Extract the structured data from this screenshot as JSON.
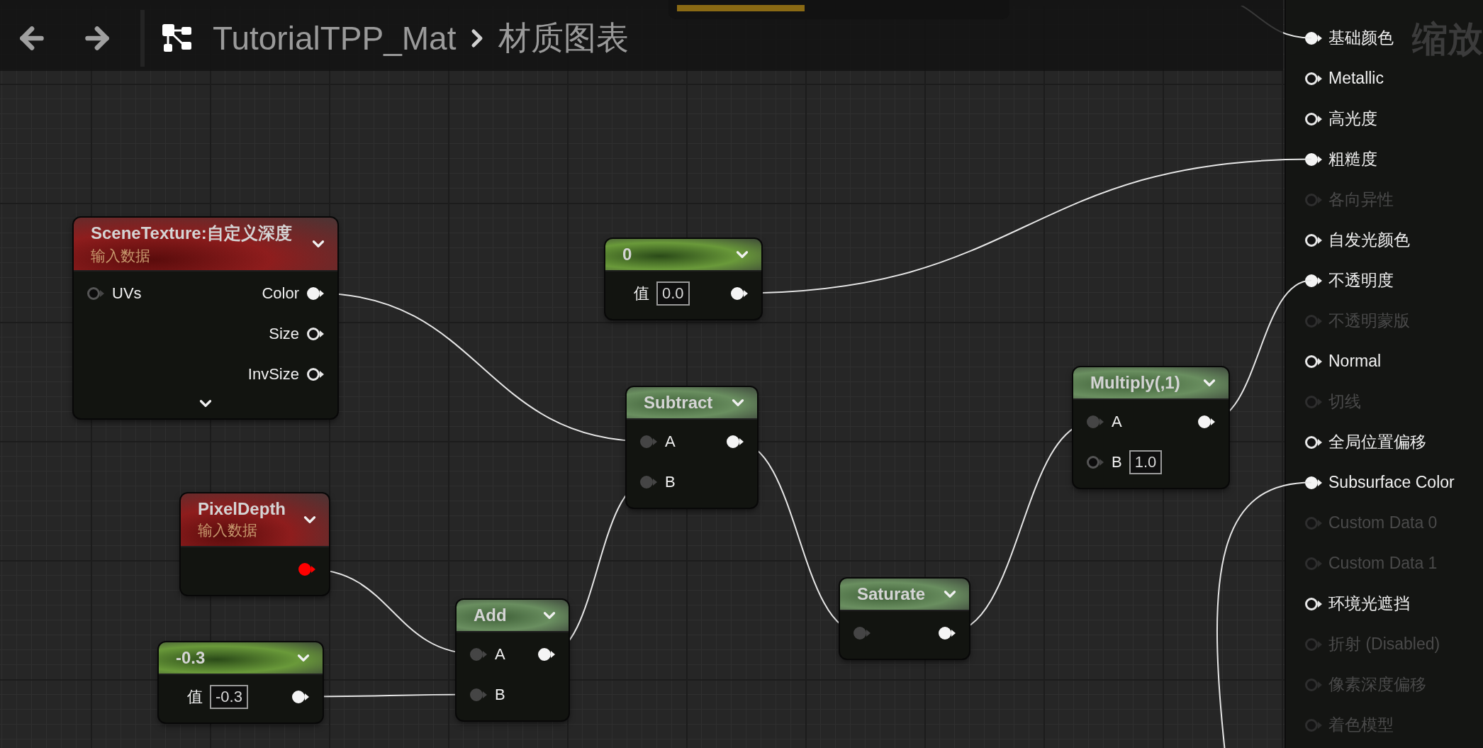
{
  "toolbar": {
    "breadcrumb": [
      {
        "label": "TutorialTPP_Mat"
      },
      {
        "label": "材质图表"
      }
    ],
    "zoom_label": "缩放"
  },
  "nodes": [
    {
      "kind": "texture",
      "title": "SceneTexture:自定义深度",
      "subtitle": "输入数据",
      "expandable": true,
      "rows": [
        {
          "input": {
            "label": "UVs",
            "connected": false
          },
          "output": {
            "label": "Color",
            "connected": true
          }
        },
        {
          "output": {
            "label": "Size",
            "connected": false
          }
        },
        {
          "output": {
            "label": "InvSize",
            "connected": false
          }
        }
      ]
    },
    {
      "kind": "constant",
      "title": "0",
      "expandable": false,
      "rows": [
        {
          "value_label": "值",
          "value": "0.0",
          "output": {
            "connected": true
          }
        }
      ]
    },
    {
      "kind": "math",
      "title": "Subtract",
      "expandable": false,
      "rows": [
        {
          "input": {
            "label": "A",
            "connected": true
          },
          "output": {
            "connected": true
          }
        },
        {
          "input": {
            "label": "B",
            "connected": true
          }
        }
      ]
    },
    {
      "kind": "texture",
      "title": "PixelDepth",
      "subtitle": "输入数据",
      "expandable": false,
      "rows": [
        {
          "output": {
            "connected": true,
            "color": "#ff0000"
          }
        }
      ]
    },
    {
      "kind": "constant",
      "title": "-0.3",
      "expandable": false,
      "rows": [
        {
          "value_label": "值",
          "value": "-0.3",
          "output": {
            "connected": true
          }
        }
      ]
    },
    {
      "kind": "math",
      "title": "Add",
      "expandable": false,
      "rows": [
        {
          "input": {
            "label": "A",
            "connected": true
          },
          "output": {
            "connected": true
          }
        },
        {
          "input": {
            "label": "B",
            "connected": true
          }
        }
      ]
    },
    {
      "kind": "math",
      "title": "Saturate",
      "expandable": false,
      "rows": [
        {
          "input": {
            "connected": true
          },
          "output": {
            "connected": true
          }
        }
      ]
    },
    {
      "kind": "math",
      "title": "Multiply(,1)",
      "expandable": false,
      "rows": [
        {
          "input": {
            "label": "A",
            "connected": true
          },
          "output": {
            "connected": true
          }
        },
        {
          "input": {
            "label": "B",
            "connected": false,
            "value": "1.0"
          }
        }
      ]
    }
  ],
  "material_outputs": [
    {
      "label": "基础颜色",
      "connected": true,
      "disabled": false
    },
    {
      "label": "Metallic",
      "connected": false,
      "disabled": false
    },
    {
      "label": "高光度",
      "connected": false,
      "disabled": false
    },
    {
      "label": "粗糙度",
      "connected": true,
      "disabled": false
    },
    {
      "label": "各向异性",
      "connected": false,
      "disabled": true
    },
    {
      "label": "自发光颜色",
      "connected": false,
      "disabled": false
    },
    {
      "label": "不透明度",
      "connected": true,
      "disabled": false
    },
    {
      "label": "不透明蒙版",
      "connected": false,
      "disabled": true
    },
    {
      "label": "Normal",
      "connected": false,
      "disabled": false
    },
    {
      "label": "切线",
      "connected": false,
      "disabled": true
    },
    {
      "label": "全局位置偏移",
      "connected": false,
      "disabled": false
    },
    {
      "label": "Subsurface Color",
      "connected": true,
      "disabled": false
    },
    {
      "label": "Custom Data 0",
      "connected": false,
      "disabled": true
    },
    {
      "label": "Custom Data 1",
      "connected": false,
      "disabled": true
    },
    {
      "label": "环境光遮挡",
      "connected": false,
      "disabled": false
    },
    {
      "label": "折射 (Disabled)",
      "connected": false,
      "disabled": true
    },
    {
      "label": "像素深度偏移",
      "connected": false,
      "disabled": true
    },
    {
      "label": "着色模型",
      "connected": false,
      "disabled": true
    }
  ]
}
